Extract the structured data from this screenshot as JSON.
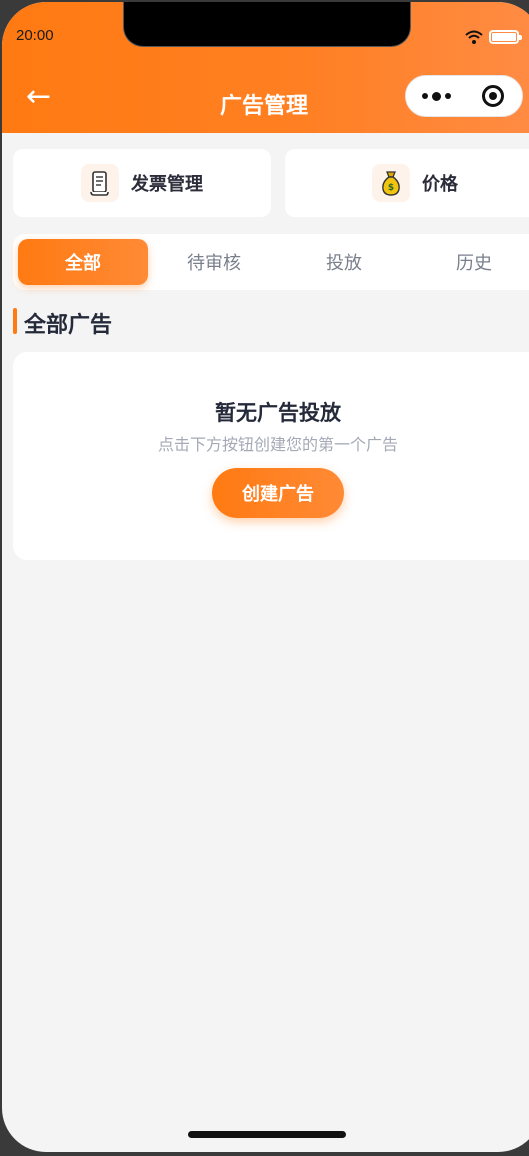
{
  "status_bar": {
    "time": "20:00"
  },
  "header": {
    "back_symbol": "←",
    "title": "广告管理",
    "accent_color": "#ff7a12"
  },
  "quick_actions": [
    {
      "label": "发票管理",
      "icon": "scroll-icon"
    },
    {
      "label": "价格",
      "icon": "money-bag-icon"
    }
  ],
  "tabs": [
    {
      "label": "全部",
      "active": true
    },
    {
      "label": "待审核",
      "active": false
    },
    {
      "label": "投放",
      "active": false
    },
    {
      "label": "历史",
      "active": false
    }
  ],
  "section": {
    "title": "全部广告"
  },
  "empty_state": {
    "title": "暂无广告投放",
    "subtitle": "点击下方按钮创建您的第一个广告",
    "button_label": "创建广告"
  }
}
